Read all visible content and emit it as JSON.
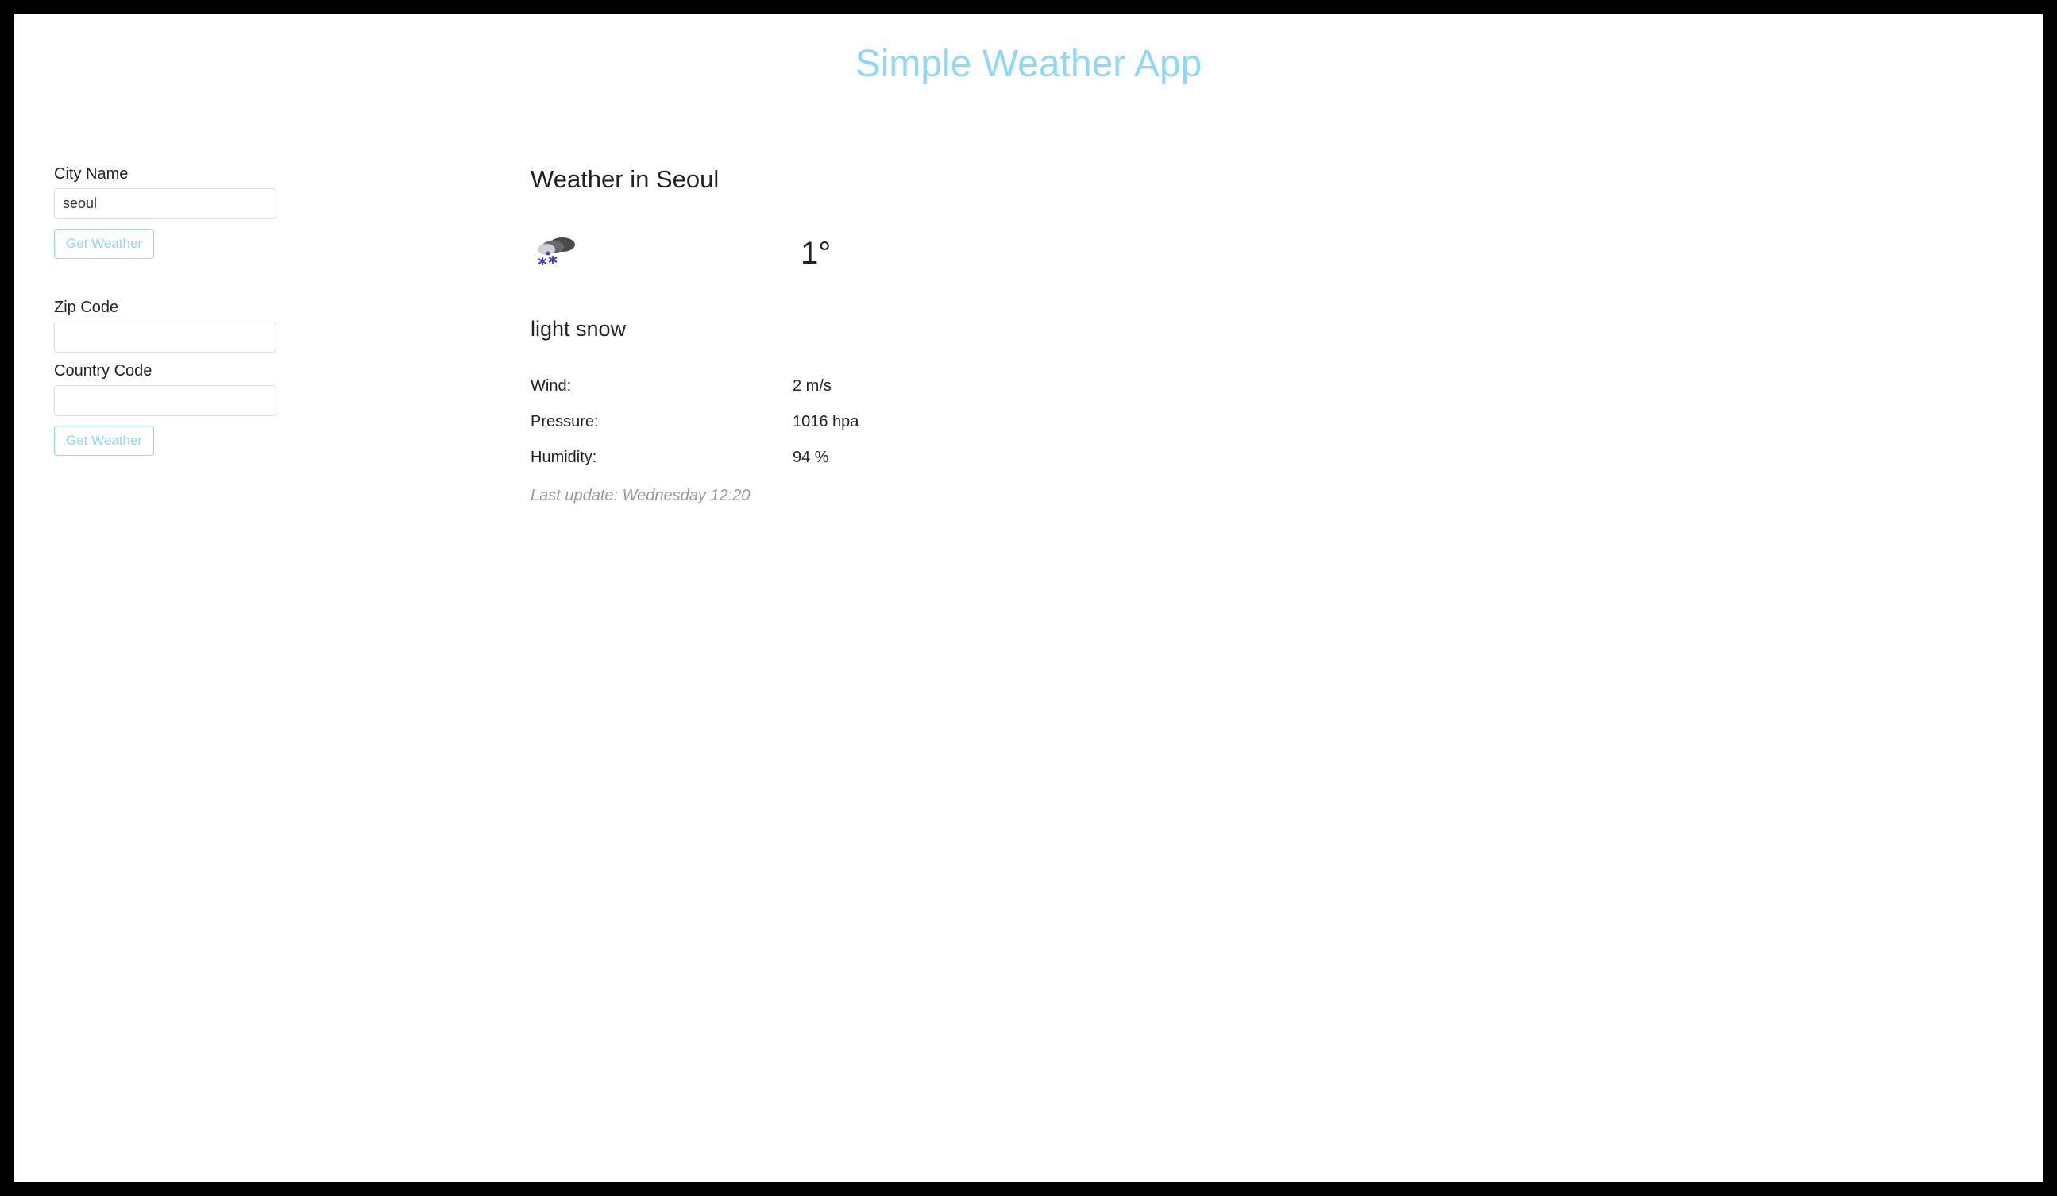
{
  "app": {
    "title": "Simple Weather App"
  },
  "forms": {
    "city": {
      "label": "City Name",
      "value": "seoul",
      "button": "Get Weather"
    },
    "zip": {
      "label": "Zip Code",
      "value": ""
    },
    "country": {
      "label": "Country Code",
      "value": "",
      "button": "Get Weather"
    }
  },
  "weather": {
    "title": "Weather in Seoul",
    "icon": "snow-cloud",
    "temperature": "1°",
    "condition": "light snow",
    "stats": {
      "wind": {
        "label": "Wind:",
        "value": "2 m/s"
      },
      "pressure": {
        "label": "Pressure:",
        "value": "1016 hpa"
      },
      "humidity": {
        "label": "Humidity:",
        "value": "94 %"
      }
    },
    "last_update": "Last update: Wednesday 12:20"
  }
}
